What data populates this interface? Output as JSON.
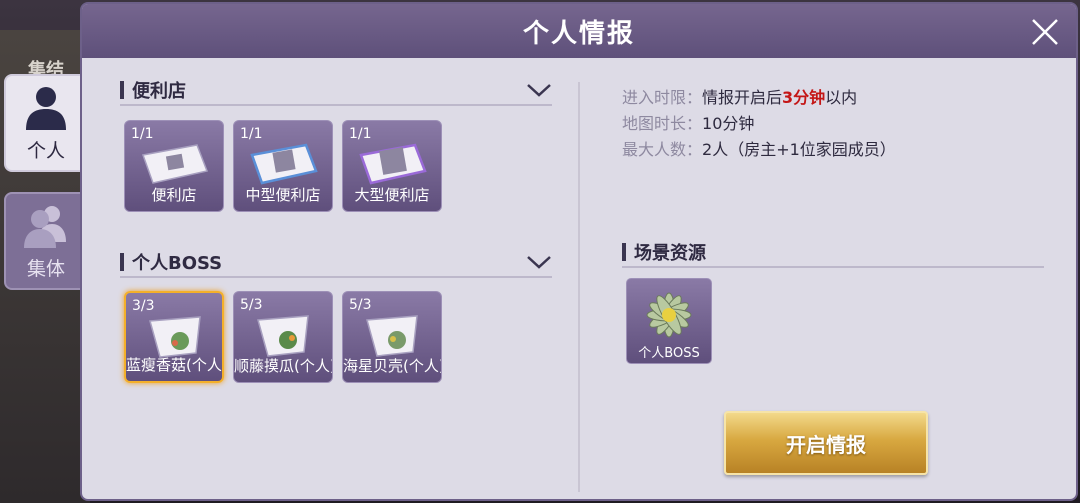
{
  "background": {
    "label": "集结"
  },
  "side_tabs": [
    {
      "label": "个人",
      "active": true,
      "icon": "person-icon"
    },
    {
      "label": "集体",
      "active": false,
      "icon": "group-icon"
    }
  ],
  "panel": {
    "title": "个人情报",
    "close_icon": "close-icon",
    "sections": [
      {
        "title": "便利店",
        "cards": [
          {
            "count": "1/1",
            "name": "便利店"
          },
          {
            "count": "1/1",
            "name": "中型便利店"
          },
          {
            "count": "1/1",
            "name": "大型便利店"
          }
        ]
      },
      {
        "title": "个人BOSS",
        "cards": [
          {
            "count": "3/3",
            "name": "蓝瘦香菇(个人)",
            "selected": true
          },
          {
            "count": "5/3",
            "name": "顺藤摸瓜(个人)"
          },
          {
            "count": "5/3",
            "name": "海星贝壳(个人)"
          }
        ]
      }
    ],
    "info": {
      "entry_label": "进入时限：",
      "entry_prefix": "情报开启后",
      "entry_highlight": "3分钟",
      "entry_suffix": "以内",
      "duration_label": "地图时长：",
      "duration_value": "10分钟",
      "max_label": "最大人数：",
      "max_value": "2人（房主+1位家园成员）"
    },
    "resources": {
      "title": "场景资源",
      "items": [
        {
          "name": "个人BOSS"
        }
      ]
    },
    "start_button": "开启情报"
  },
  "colors": {
    "header": "#6a5b85",
    "panel_bg": "#dddbe6",
    "card": "#7a6a97",
    "highlight_red": "#c41616",
    "gold": "#d8a840",
    "selected_border": "#f4b02a"
  }
}
